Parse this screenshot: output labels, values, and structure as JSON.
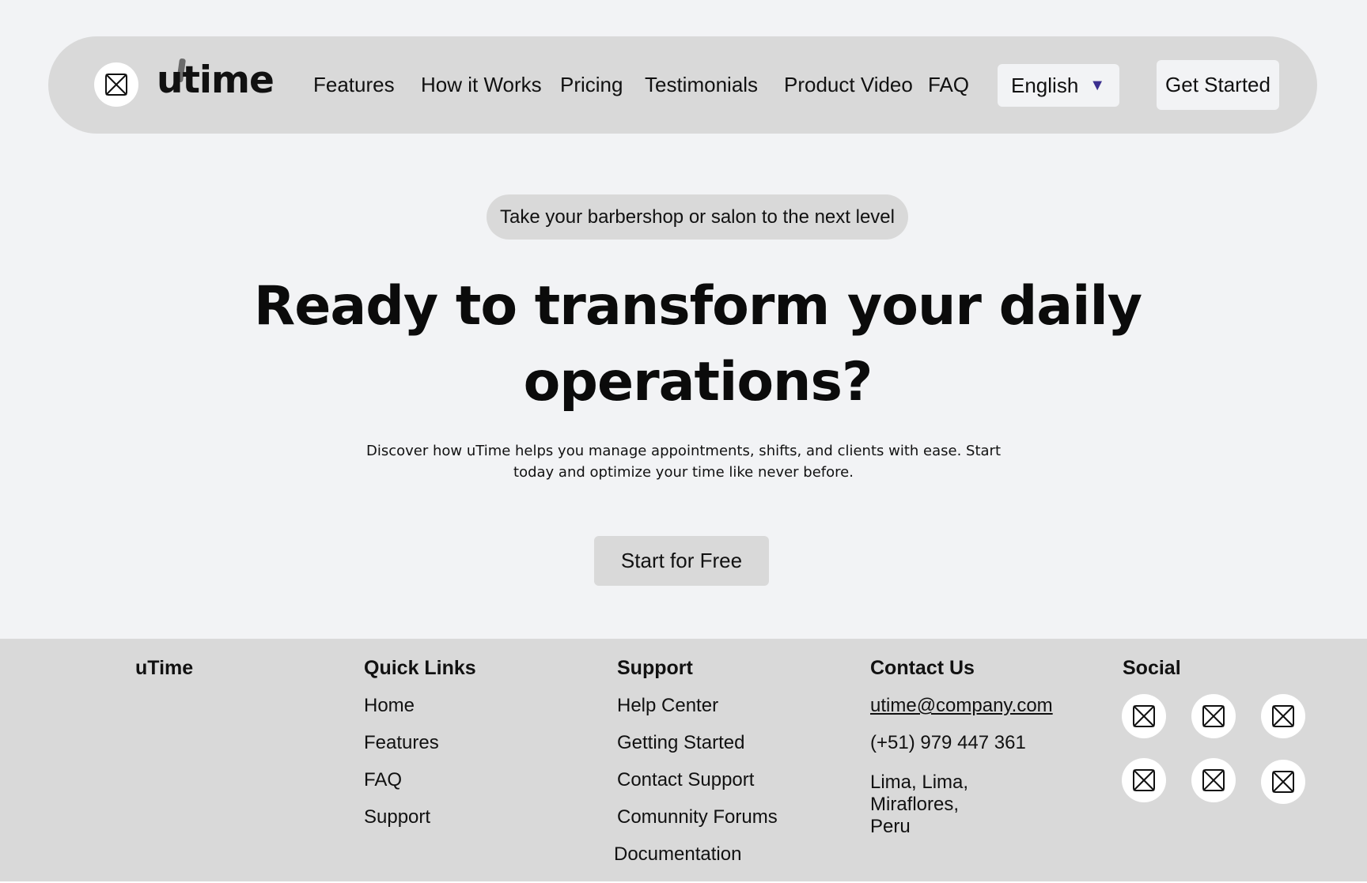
{
  "nav": {
    "logo_icon": "image-placeholder-icon",
    "logo_text": "utime",
    "links": [
      "Features",
      "How it Works",
      "Pricing",
      "Testimonials",
      "Product Video",
      "FAQ"
    ],
    "language": "English",
    "language_caret": "▼",
    "cta": "Get Started"
  },
  "hero": {
    "badge": "Take your barbershop or salon to the next level",
    "headline_line1": "Ready to transform your daily",
    "headline_line2": "operations?",
    "subtext": "Discover how uTime helps you manage appointments, shifts, and clients with ease. Start today and optimize your time like never before.",
    "cta": "Start for Free"
  },
  "footer": {
    "brand": "uTime",
    "quick_links": {
      "title": "Quick Links",
      "items": [
        "Home",
        "Features",
        "FAQ",
        "Support"
      ]
    },
    "support": {
      "title": "Support",
      "items": [
        "Help Center",
        "Getting Started",
        "Contact Support",
        "Comunnity Forums",
        "Documentation"
      ]
    },
    "contact": {
      "title": "Contact Us",
      "email": "utime@company.com",
      "phone": "(+51) 979 447 361",
      "address": "Lima, Lima, Miraflores, Peru"
    },
    "social": {
      "title": "Social",
      "icons": [
        "image-placeholder-icon",
        "image-placeholder-icon",
        "image-placeholder-icon",
        "image-placeholder-icon",
        "image-placeholder-icon",
        "image-placeholder-icon"
      ]
    }
  },
  "colors": {
    "background": "#f2f3f5",
    "panel": "#d9d9d9",
    "caret": "#3b2f8f"
  }
}
